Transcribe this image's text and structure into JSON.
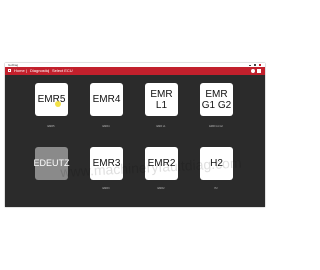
{
  "window": {
    "app_title": "GoDiag"
  },
  "menubar": {
    "nav": [
      "Home",
      "Diagnostic",
      "Select ECU"
    ],
    "separator": "|",
    "accent_color": "#c2202c"
  },
  "tiles": [
    {
      "label": "EMR5",
      "caption": "EMR5",
      "enabled": true
    },
    {
      "label": "EMR4",
      "caption": "EMR4",
      "enabled": true
    },
    {
      "label": "EMR\nL1",
      "caption": "EMR L1",
      "enabled": true
    },
    {
      "label": "EMR\nG1 G2",
      "caption": "EMR G1 G2",
      "enabled": true
    },
    {
      "label": "EDEUTZ",
      "caption": "",
      "enabled": false
    },
    {
      "label": "EMR3",
      "caption": "EMR3",
      "enabled": true
    },
    {
      "label": "EMR2",
      "caption": "EMR2",
      "enabled": true
    },
    {
      "label": "H2",
      "caption": "H2",
      "enabled": true
    }
  ],
  "watermark": "www.machineryfaultdiag.com"
}
